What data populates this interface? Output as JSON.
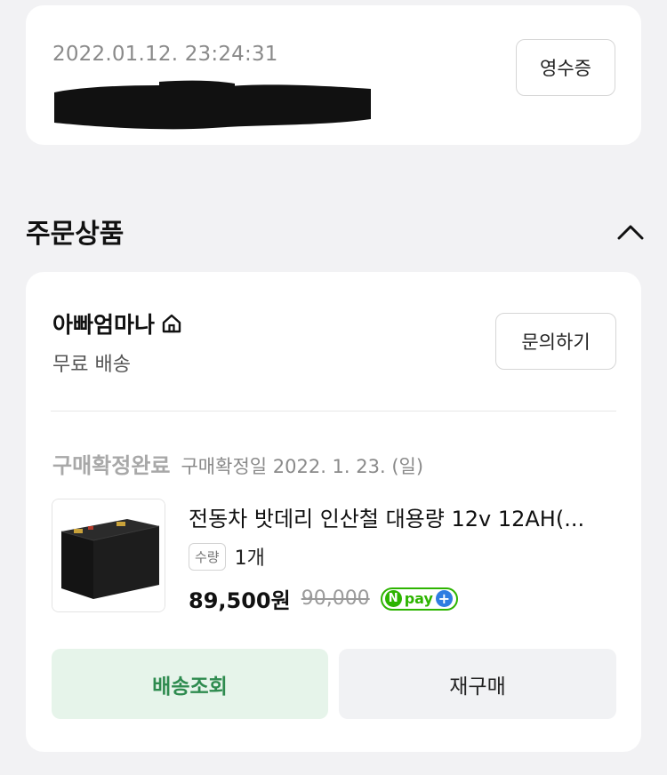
{
  "order": {
    "datetime": "2022.01.12. 23:24:31",
    "receipt_label": "영수증"
  },
  "section": {
    "title": "주문상품"
  },
  "store": {
    "name": "아빠엄마나",
    "shipping": "무료 배송",
    "inquiry_label": "문의하기"
  },
  "status": {
    "label": "구매확정완료",
    "confirm_date": "구매확정일 2022. 1. 23. (일)"
  },
  "product": {
    "name": "전동차 밧데리 인산철 대용량 12v 12AH(...",
    "qty_label": "수량",
    "qty_value": "1개",
    "price": "89,500원",
    "original_price": "90,000",
    "npay_letter": "N",
    "npay_text": "pay",
    "npay_plus": "+"
  },
  "actions": {
    "track_label": "배송조회",
    "rebuy_label": "재구매"
  },
  "colors": {
    "status_gray": "#a8a8a8",
    "track_bg": "#e6f4ea",
    "track_text": "#2e8b4f",
    "npay_green": "#2db400",
    "npay_blue": "#2f7de1"
  }
}
